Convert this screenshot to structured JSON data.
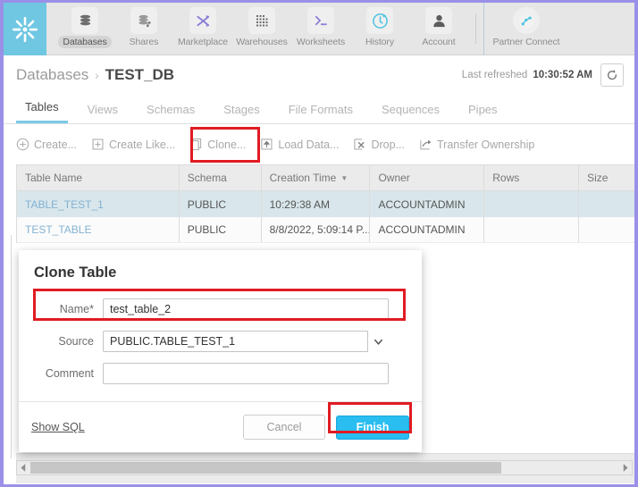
{
  "nav": {
    "logo": "snowflake-logo",
    "items": [
      {
        "label": "Databases",
        "icon": "database-icon",
        "active": true
      },
      {
        "label": "Shares",
        "icon": "shares-icon",
        "active": false
      },
      {
        "label": "Marketplace",
        "icon": "shuffle-icon",
        "active": false
      },
      {
        "label": "Warehouses",
        "icon": "grid-icon",
        "active": false
      },
      {
        "label": "Worksheets",
        "icon": "terminal-icon",
        "active": false
      },
      {
        "label": "History",
        "icon": "clock-arrow-icon",
        "active": false
      },
      {
        "label": "Account",
        "icon": "user-icon",
        "active": false
      }
    ],
    "partner": {
      "label": "Partner Connect",
      "icon": "partner-connect-icon"
    }
  },
  "breadcrumb": {
    "root": "Databases",
    "separator": "›",
    "current": "TEST_DB"
  },
  "refresh": {
    "label": "Last refreshed",
    "time": "10:30:52 AM",
    "icon": "refresh-icon"
  },
  "tabs": [
    {
      "label": "Tables",
      "active": true
    },
    {
      "label": "Views",
      "active": false
    },
    {
      "label": "Schemas",
      "active": false
    },
    {
      "label": "Stages",
      "active": false
    },
    {
      "label": "File Formats",
      "active": false
    },
    {
      "label": "Sequences",
      "active": false
    },
    {
      "label": "Pipes",
      "active": false
    }
  ],
  "toolbar": [
    {
      "label": "Create...",
      "icon": "plus-circle-icon"
    },
    {
      "label": "Create Like...",
      "icon": "copy-plus-icon"
    },
    {
      "label": "Clone...",
      "icon": "clone-icon",
      "highlighted": true
    },
    {
      "label": "Load Data...",
      "icon": "upload-icon"
    },
    {
      "label": "Drop...",
      "icon": "drop-x-icon"
    },
    {
      "label": "Transfer Ownership",
      "icon": "transfer-icon"
    }
  ],
  "table": {
    "columns": [
      "Table Name",
      "Schema",
      "Creation Time",
      "Owner",
      "Rows",
      "Size"
    ],
    "sorted_column": "Creation Time",
    "sort_caret": "▼",
    "rows": [
      {
        "name": "TABLE_TEST_1",
        "schema": "PUBLIC",
        "created": "10:29:38 AM",
        "owner": "ACCOUNTADMIN",
        "rows": "",
        "size": "",
        "selected": true
      },
      {
        "name": "TEST_TABLE",
        "schema": "PUBLIC",
        "created": "8/8/2022, 5:09:14 P...",
        "owner": "ACCOUNTADMIN",
        "rows": "",
        "size": "",
        "selected": false
      }
    ]
  },
  "modal": {
    "title": "Clone Table",
    "fields": [
      {
        "label": "Name",
        "required": true,
        "required_mark": "*",
        "value": "test_table_2",
        "placeholder": "",
        "type": "text",
        "highlighted": true
      },
      {
        "label": "Source",
        "required": false,
        "required_mark": "",
        "value": "PUBLIC.TABLE_TEST_1",
        "placeholder": "",
        "type": "select",
        "caret": "⌄"
      },
      {
        "label": "Comment",
        "required": false,
        "required_mark": "",
        "value": "",
        "placeholder": "",
        "type": "text"
      }
    ],
    "show_sql": "Show SQL",
    "cancel": "Cancel",
    "finish": "Finish"
  },
  "scrollbar": {
    "left_arrow": "◀",
    "right_arrow": "▶"
  },
  "colors": {
    "accent": "#29bdf0",
    "logo_bg": "#6fc7e1",
    "highlight": "#e01b22",
    "selected_row": "#d9e7ec",
    "link": "#83b2d2"
  }
}
